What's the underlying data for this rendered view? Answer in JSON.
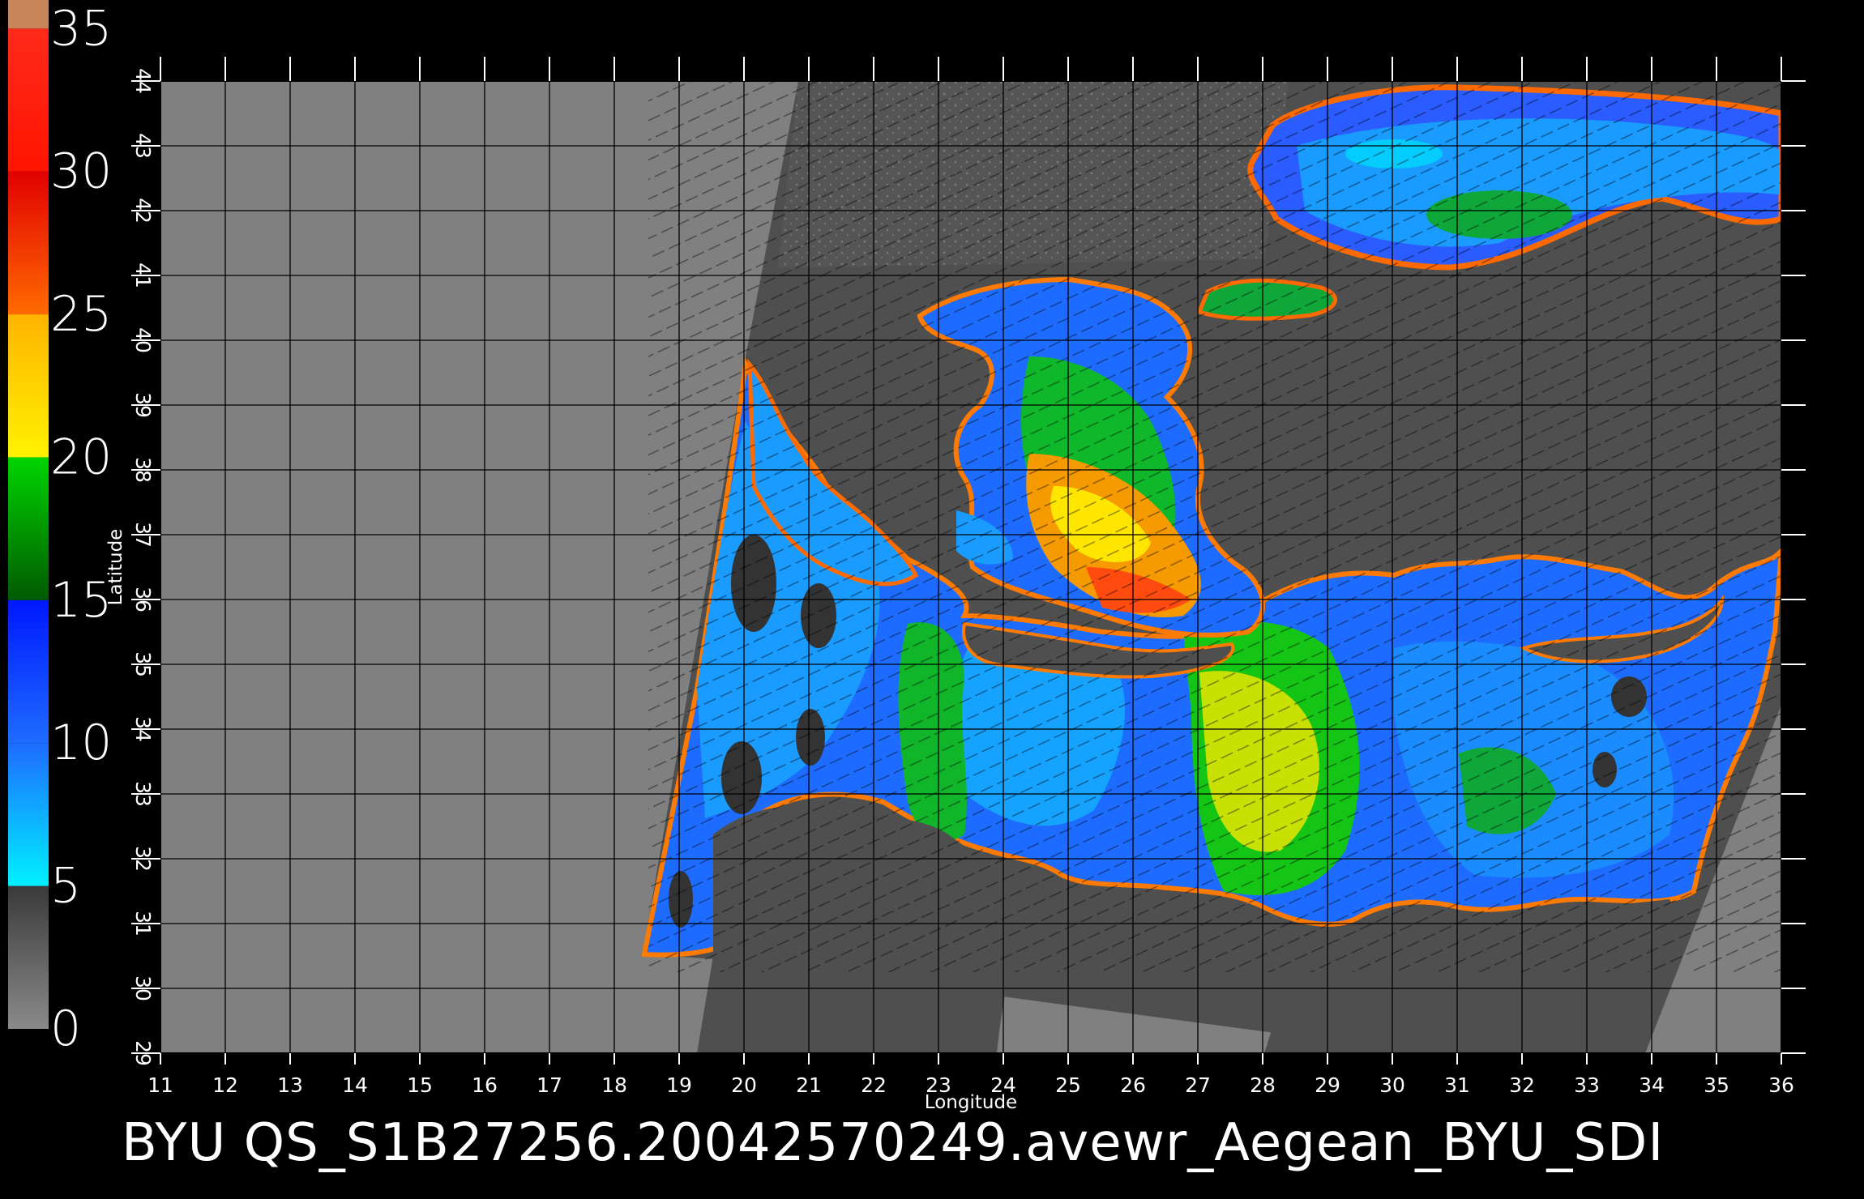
{
  "footer": {
    "text": "BYU  QS_S1B27256.20042570249.avewr_Aegean_BYU_SDI"
  },
  "map": {
    "xlabel": "Longitude",
    "ylabel": "Latitude",
    "lon_range": [
      11,
      36
    ],
    "lat_range": [
      29,
      44
    ],
    "lon_ticks": [
      "11",
      "12",
      "13",
      "14",
      "15",
      "16",
      "17",
      "18",
      "19",
      "20",
      "21",
      "22",
      "23",
      "24",
      "25",
      "26",
      "27",
      "28",
      "29",
      "30",
      "31",
      "32",
      "33",
      "34",
      "35",
      "36"
    ],
    "lat_ticks": [
      "29",
      "30",
      "31",
      "32",
      "33",
      "34",
      "35",
      "36",
      "37",
      "38",
      "39",
      "40",
      "41",
      "42",
      "43",
      "44"
    ],
    "colors": {
      "no_data": "#808080",
      "land": "#4f4f4f",
      "grid": "#000000"
    }
  },
  "colorbar": {
    "labels": [
      "0",
      "5",
      "10",
      "15",
      "20",
      "25",
      "30",
      "35"
    ],
    "range": [
      0,
      35
    ],
    "bands": [
      {
        "from": 0,
        "to": 5,
        "color_top": "#3a3a3a",
        "color_bottom": "#8a8a8a"
      },
      {
        "from": 5,
        "to": 10,
        "color_top": "#1e6cff",
        "color_bottom": "#00f0ff"
      },
      {
        "from": 10,
        "to": 15,
        "color_top": "#0018ff",
        "color_bottom": "#1e6cff"
      },
      {
        "from": 15,
        "to": 20,
        "color_top": "#00d400",
        "color_bottom": "#005a00"
      },
      {
        "from": 20,
        "to": 25,
        "color_top": "#ffb400",
        "color_bottom": "#fff200"
      },
      {
        "from": 25,
        "to": 30,
        "color_top": "#e00000",
        "color_bottom": "#ff6a00"
      },
      {
        "from": 30,
        "to": 35,
        "color_top": "#ff2a1a",
        "color_bottom": "#ff1500"
      },
      {
        "from": 35,
        "to": 36,
        "color_top": "#c8855a",
        "color_bottom": "#c8855a"
      }
    ]
  },
  "chart_data": {
    "type": "heatmap",
    "title": "",
    "xlabel": "Longitude",
    "ylabel": "Latitude",
    "xlim": [
      11,
      36
    ],
    "ylim": [
      29,
      44
    ],
    "colorbar_range": [
      0,
      35
    ],
    "colorbar_ticks": [
      0,
      5,
      10,
      15,
      20,
      25,
      30,
      35
    ],
    "grid": true
  }
}
